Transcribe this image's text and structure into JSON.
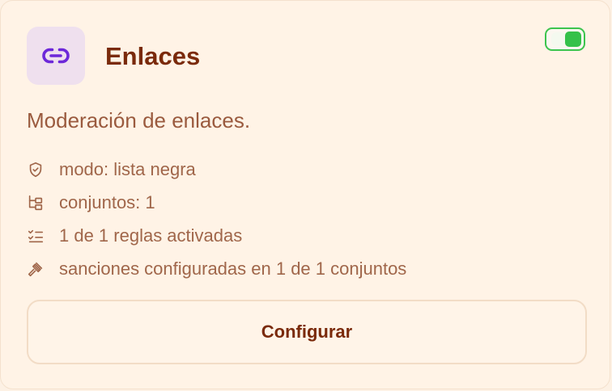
{
  "card": {
    "title": "Enlaces",
    "description": "Moderación de enlaces.",
    "icon": "link-icon",
    "enabled": true,
    "toggle_color": "#34c14a",
    "accent_color": "#6d28d9",
    "info": [
      {
        "icon": "shield-check-icon",
        "text": "modo: lista negra"
      },
      {
        "icon": "folder-tree-icon",
        "text": "conjuntos: 1"
      },
      {
        "icon": "list-checks-icon",
        "text": "1 de 1 reglas activadas"
      },
      {
        "icon": "gavel-icon",
        "text": "sanciones configuradas en 1 de 1 conjuntos"
      }
    ],
    "button_label": "Configurar"
  }
}
